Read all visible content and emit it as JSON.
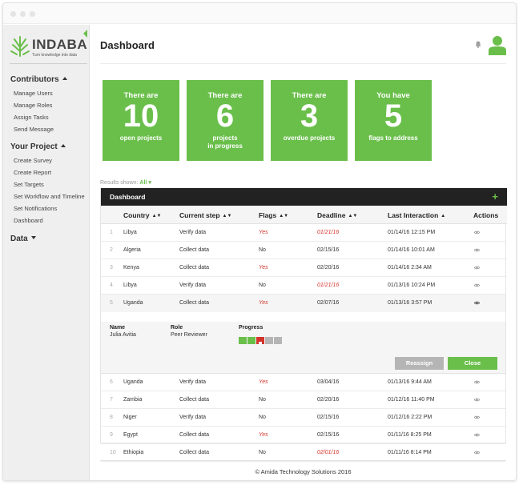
{
  "brand": {
    "name": "INDABA",
    "tagline": "Turn knowledge into data",
    "accent": "#6abf4b"
  },
  "sidebar": {
    "sections": [
      {
        "label": "Contributors",
        "expanded": true,
        "items": [
          "Manage Users",
          "Manage Roles",
          "Assign Tasks",
          "Send Message"
        ]
      },
      {
        "label": "Your Project",
        "expanded": true,
        "items": [
          "Create Survey",
          "Create Report",
          "Set Targets",
          "Set Workflow and Timeline",
          "Set Notifications",
          "Dashboard"
        ]
      },
      {
        "label": "Data",
        "expanded": false,
        "items": []
      }
    ]
  },
  "header": {
    "title": "Dashboard",
    "icons": [
      "bell-icon",
      "user-avatar-icon"
    ]
  },
  "cards": [
    {
      "line1": "There are",
      "number": "10",
      "line3": "open projects"
    },
    {
      "line1": "There are",
      "number": "6",
      "line3": "projects\nin progress"
    },
    {
      "line1": "There are",
      "number": "3",
      "line3": "overdue projects"
    },
    {
      "line1": "You have",
      "number": "5",
      "line3": "flags to address"
    }
  ],
  "results": {
    "label": "Results shown:",
    "value": "All"
  },
  "table": {
    "title": "Dashboard",
    "add_icon": "plus-icon",
    "columns": [
      "Country",
      "Current step",
      "Flags",
      "Deadline",
      "Last Interaction",
      "Actions"
    ],
    "rows": [
      {
        "num": "1",
        "country": "Libya",
        "step": "Verify data",
        "flags": "Yes",
        "deadline": "01/21/16",
        "overdue": true,
        "last": "01/14/16 12:15 PM"
      },
      {
        "num": "2",
        "country": "Algeria",
        "step": "Collect data",
        "flags": "No",
        "deadline": "02/15/16",
        "overdue": false,
        "last": "01/14/16 10:01 AM"
      },
      {
        "num": "3",
        "country": "Kenya",
        "step": "Collect data",
        "flags": "Yes",
        "deadline": "02/20/16",
        "overdue": false,
        "last": "01/14/16 2:34 AM"
      },
      {
        "num": "4",
        "country": "Libya",
        "step": "Verify data",
        "flags": "No",
        "deadline": "01/21/16",
        "overdue": true,
        "last": "01/13/16 10:24 PM"
      },
      {
        "num": "5",
        "country": "Uganda",
        "step": "Collect data",
        "flags": "Yes",
        "deadline": "02/07/16",
        "overdue": false,
        "last": "01/13/16 3:57 PM"
      },
      {
        "num": "6",
        "country": "Uganda",
        "step": "Verify data",
        "flags": "Yes",
        "deadline": "03/04/16",
        "overdue": false,
        "last": "01/13/16 9:44 AM"
      },
      {
        "num": "7",
        "country": "Zambia",
        "step": "Collect data",
        "flags": "No",
        "deadline": "02/20/16",
        "overdue": false,
        "last": "01/12/16 11:40 PM"
      },
      {
        "num": "8",
        "country": "Niger",
        "step": "Verify data",
        "flags": "No",
        "deadline": "02/15/16",
        "overdue": false,
        "last": "01/12/16 2:22 PM"
      },
      {
        "num": "9",
        "country": "Egypt",
        "step": "Collect data",
        "flags": "Yes",
        "deadline": "02/15/16",
        "overdue": false,
        "last": "01/11/16 8:25 PM"
      },
      {
        "num": "10",
        "country": "Ethiopia",
        "step": "Collect data",
        "flags": "No",
        "deadline": "02/01/16",
        "overdue": true,
        "last": "01/11/16 8:14 PM"
      }
    ],
    "expanded_row": {
      "name_label": "Name",
      "name": "Julia Avitia",
      "role_label": "Role",
      "role": "Peer Reviewer",
      "progress_label": "Progress",
      "progress_steps": [
        "done",
        "done",
        "flagged",
        "pending",
        "pending"
      ],
      "progress_colors": {
        "done": "#6abf4b",
        "flagged": "#d4332a",
        "pending": "#b5b5b5"
      },
      "reassign_label": "Reassign",
      "close_label": "Close"
    }
  },
  "footer": {
    "text": "© Amida Technology Solutions 2016"
  }
}
